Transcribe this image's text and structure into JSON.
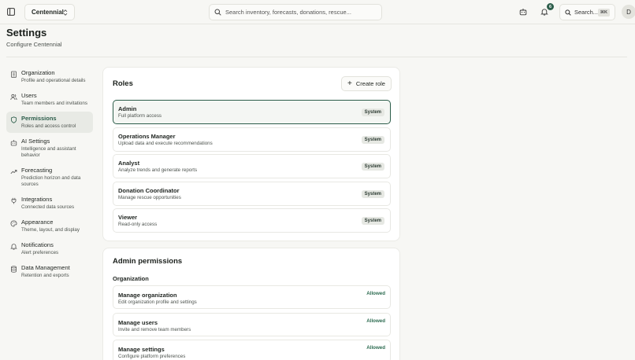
{
  "topbar": {
    "org_name": "Centennial",
    "search_placeholder": "Search inventory, forecasts, donations, rescue...",
    "notification_count": "6",
    "quick_search_label": "Search...",
    "quick_search_shortcut": "⌘K",
    "avatar_initial": "D"
  },
  "page": {
    "title": "Settings",
    "subtitle": "Configure Centennial"
  },
  "sidebar": {
    "items": [
      {
        "label": "Organization",
        "desc": "Profile and operational details",
        "icon": "building-icon"
      },
      {
        "label": "Users",
        "desc": "Team members and invitations",
        "icon": "users-icon"
      },
      {
        "label": "Permissions",
        "desc": "Roles and access control",
        "icon": "shield-icon"
      },
      {
        "label": "AI Settings",
        "desc": "Intelligence and assistant behavior",
        "icon": "robot-icon"
      },
      {
        "label": "Forecasting",
        "desc": "Prediction horizon and data sources",
        "icon": "trending-up-icon"
      },
      {
        "label": "Integrations",
        "desc": "Connected data sources",
        "icon": "plug-icon"
      },
      {
        "label": "Appearance",
        "desc": "Theme, layout, and display",
        "icon": "palette-icon"
      },
      {
        "label": "Notifications",
        "desc": "Alert preferences",
        "icon": "bell-icon"
      },
      {
        "label": "Data Management",
        "desc": "Retention and exports",
        "icon": "database-icon"
      }
    ],
    "active_index": 2
  },
  "roles": {
    "title": "Roles",
    "create_label": "Create role",
    "items": [
      {
        "name": "Admin",
        "desc": "Full platform access",
        "badge": "System"
      },
      {
        "name": "Operations Manager",
        "desc": "Upload data and execute recommendations",
        "badge": "System"
      },
      {
        "name": "Analyst",
        "desc": "Analyze trends and generate reports",
        "badge": "System"
      },
      {
        "name": "Donation Coordinator",
        "desc": "Manage rescue opportunities",
        "badge": "System"
      },
      {
        "name": "Viewer",
        "desc": "Read-only access",
        "badge": "System"
      }
    ]
  },
  "permissions": {
    "title": "Admin permissions",
    "section": "Organization",
    "items": [
      {
        "name": "Manage organization",
        "desc": "Edit organization profile and settings",
        "status": "Allowed"
      },
      {
        "name": "Manage users",
        "desc": "Invite and remove team members",
        "status": "Allowed"
      },
      {
        "name": "Manage settings",
        "desc": "Configure platform preferences",
        "status": "Allowed"
      }
    ]
  },
  "colors": {
    "accent": "#2c5d4a",
    "background": "#f7f7f4",
    "card": "#ffffff"
  }
}
